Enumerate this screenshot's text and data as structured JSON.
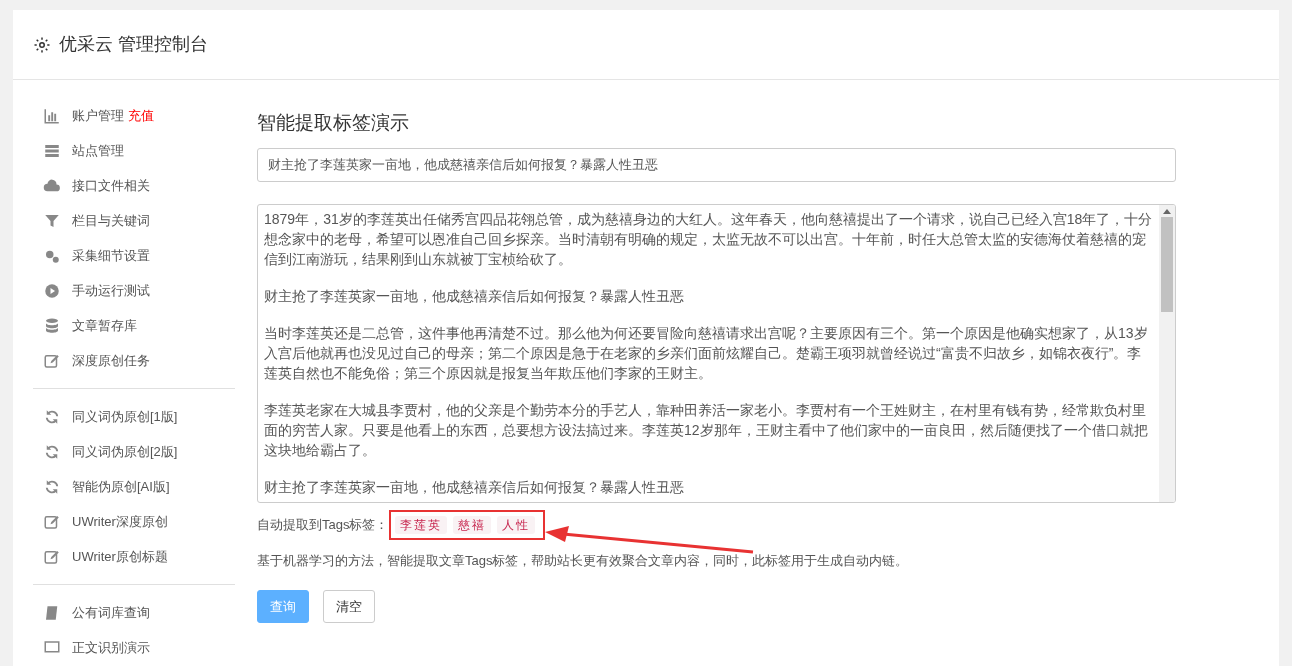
{
  "header": {
    "title": "优采云 管理控制台"
  },
  "sidebar": {
    "groups": [
      {
        "items": [
          {
            "label": "账户管理",
            "badge": "充值"
          },
          {
            "label": "站点管理"
          },
          {
            "label": "接口文件相关"
          },
          {
            "label": "栏目与关键词"
          },
          {
            "label": "采集细节设置"
          },
          {
            "label": "手动运行测试"
          },
          {
            "label": "文章暂存库"
          },
          {
            "label": "深度原创任务"
          }
        ]
      },
      {
        "items": [
          {
            "label": "同义词伪原创[1版]"
          },
          {
            "label": "同义词伪原创[2版]"
          },
          {
            "label": "智能伪原创[AI版]"
          },
          {
            "label": "UWriter深度原创"
          },
          {
            "label": "UWriter原创标题"
          }
        ]
      },
      {
        "items": [
          {
            "label": "公有词库查询"
          },
          {
            "label": "正文识别演示"
          }
        ]
      }
    ]
  },
  "main": {
    "title": "智能提取标签演示",
    "title_field": {
      "value": "财主抢了李莲英家一亩地，他成慈禧亲信后如何报复？暴露人性丑恶"
    },
    "content_field": {
      "paragraphs": [
        "1879年，31岁的李莲英出任储秀宫四品花翎总管，成为慈禧身边的大红人。这年春天，他向慈禧提出了一个请求，说自己已经入宫18年了，十分想念家中的老母，希望可以恩准自己回乡探亲。当时清朝有明确的规定，太监无故不可以出宫。十年前，时任大总管太监的安德海仗着慈禧的宠信到江南游玩，结果刚到山东就被丁宝桢给砍了。",
        "财主抢了李莲英家一亩地，他成慈禧亲信后如何报复？暴露人性丑恶",
        "当时李莲英还是二总管，这件事他再清楚不过。那么他为何还要冒险向慈禧请求出宫呢？主要原因有三个。第一个原因是他确实想家了，从13岁入宫后他就再也没见过自己的母亲；第二个原因是急于在老家的乡亲们面前炫耀自己。楚霸王项羽就曾经说过“富贵不归故乡，如锦衣夜行”。李莲英自然也不能免俗；第三个原因就是报复当年欺压他们李家的王财主。",
        "李莲英老家在大城县李贾村，他的父亲是个勤劳本分的手艺人，靠种田养活一家老小。李贾村有一个王姓财主，在村里有钱有势，经常欺负村里面的穷苦人家。只要是他看上的东西，总要想方设法搞过来。李莲英12岁那年，王财主看中了他们家中的一亩良田，然后随便找了一个借口就把这块地给霸占了。",
        "财主抢了李莲英家一亩地，他成慈禧亲信后如何报复？暴露人性丑恶"
      ]
    },
    "tags_label": "自动提取到Tags标签：",
    "tags": [
      "李莲英",
      "慈禧",
      "人性"
    ],
    "description": "基于机器学习的方法，智能提取文章Tags标签，帮助站长更有效聚合文章内容，同时，此标签用于生成自动内链。",
    "buttons": [
      {
        "label": "查询",
        "kind": "primary"
      },
      {
        "label": "清空",
        "kind": "default"
      }
    ]
  }
}
